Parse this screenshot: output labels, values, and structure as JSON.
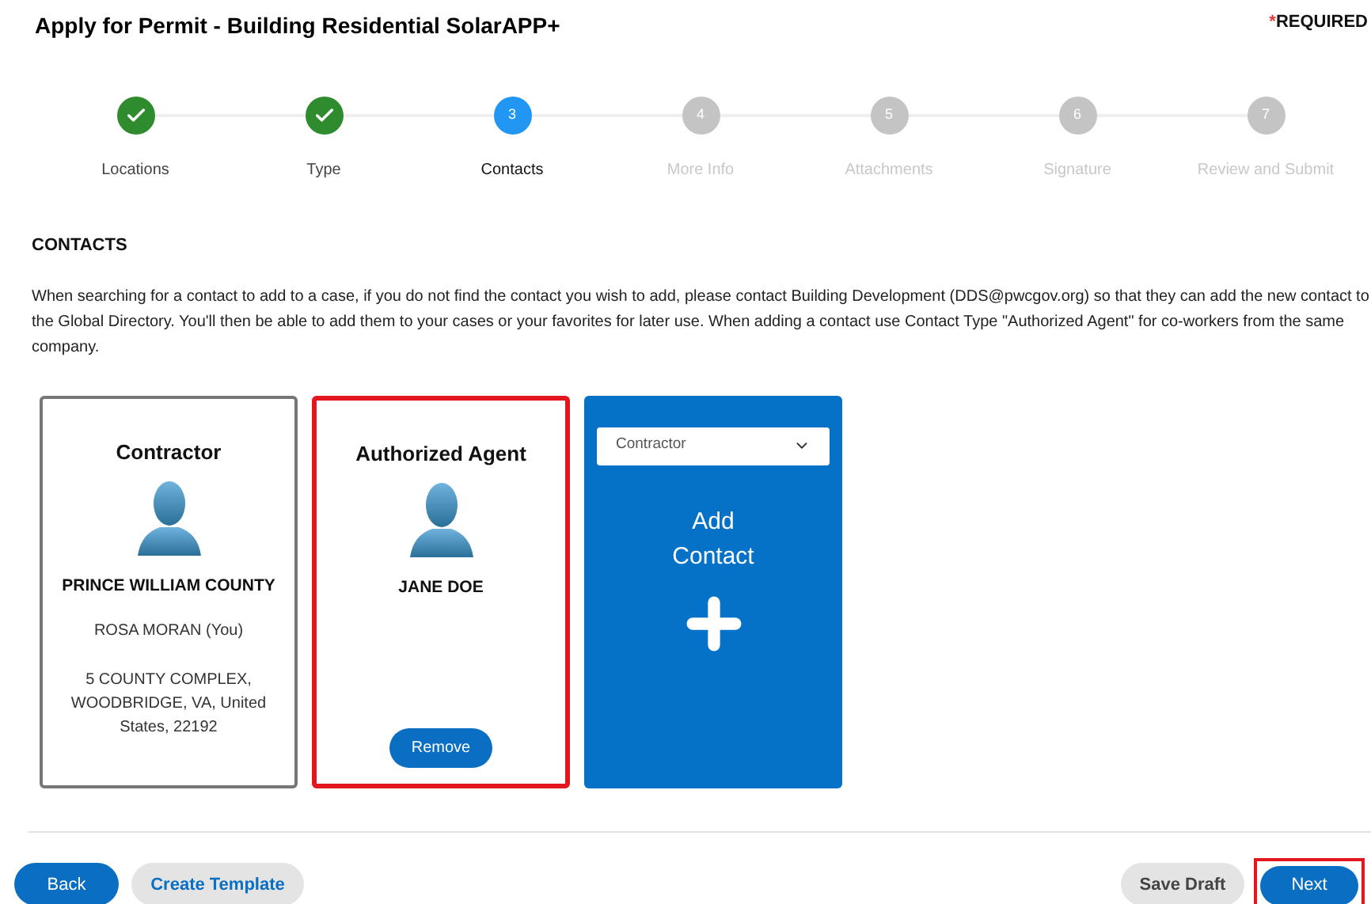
{
  "title": "Apply for Permit - Building Residential SolarAPP+",
  "required": {
    "mark": "*",
    "label": "REQUIRED"
  },
  "steps": [
    {
      "label": "Locations",
      "completed": true,
      "selected": false
    },
    {
      "label": "Type",
      "completed": true,
      "selected": false
    },
    {
      "number": "3",
      "label": "Contacts",
      "completed": false,
      "selected": true
    },
    {
      "number": "4",
      "label": "More Info",
      "completed": false,
      "selected": false
    },
    {
      "number": "5",
      "label": "Attachments",
      "completed": false,
      "selected": false
    },
    {
      "number": "6",
      "label": "Signature",
      "completed": false,
      "selected": false
    },
    {
      "number": "7",
      "label": "Review and Submit",
      "completed": false,
      "selected": false
    }
  ],
  "section_title": "CONTACTS",
  "instructions": "When searching for a contact to add to a case, if you do not find the contact you wish to add, please contact Building Development (DDS@pwcgov.org) so that they can add the new contact to the Global Directory. You'll then be able to add them to your cases or your favorites for later use. When adding a contact use Contact Type \"Authorized Agent\" for co-workers from the same company.",
  "contacts": [
    {
      "type": "Contractor",
      "name": "PRINCE WILLIAM COUNTY",
      "person": "ROSA MORAN (You)",
      "address": "5 COUNTY COMPLEX, WOODBRIDGE, VA, United States, 22192",
      "highlighted": false
    },
    {
      "type": "Authorized Agent",
      "name": "JANE DOE",
      "remove_button": "Remove",
      "highlighted": true
    }
  ],
  "add_contact": {
    "select_value": "Contractor",
    "label": "Add Contact"
  },
  "footer": {
    "back": "Back",
    "create_template": "Create Template",
    "save_draft": "Save Draft",
    "next": "Next",
    "next_highlighted": true
  }
}
